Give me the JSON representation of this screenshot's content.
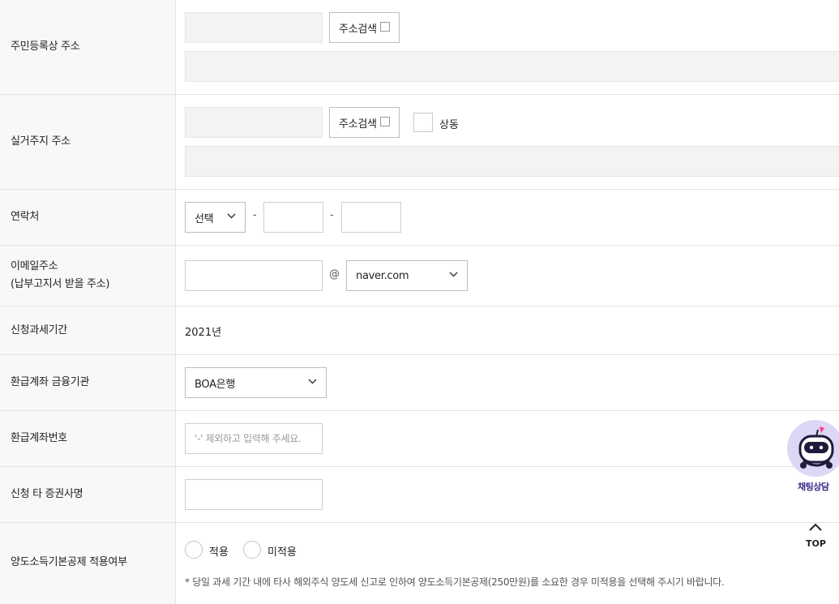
{
  "fields": {
    "resident_address": {
      "label": "주민등록상 주소",
      "search_button": "주소검색"
    },
    "actual_address": {
      "label": "실거주지 주소",
      "search_button": "주소검색",
      "same_checkbox_label": "상동"
    },
    "contact": {
      "label": "연락처",
      "prefix_selected": "선택",
      "separator": "-"
    },
    "email": {
      "label_line1": "이메일주소",
      "label_line2": "(납부고지서 받을 주소)",
      "at": "@",
      "domain_selected": "naver.com"
    },
    "tax_period": {
      "label": "신청과세기간",
      "value": "2021년"
    },
    "refund_bank": {
      "label": "환급계좌 금융기관",
      "selected": "BOA은행"
    },
    "refund_account": {
      "label": "환급계좌번호",
      "placeholder": "'-' 제외하고 입력해 주세요."
    },
    "other_broker": {
      "label": "신청 타 증권사명"
    },
    "deduction": {
      "label": "양도소득기본공제 적용여부",
      "options": [
        "적용",
        "미적용"
      ],
      "notice": "* 당일 과세 기간 내에 타사 해외주식 양도세 신고로 인하여 양도소득기본공제(250만원)를 소요한 경우 미적용을 선택해 주시기 바랍니다."
    }
  },
  "floating": {
    "chat_label": "채팅상담",
    "top_label": "TOP"
  },
  "colors": {
    "chat_accent": "#3b2a87",
    "chat_bubble": "#dcd7f5",
    "readonly_bg": "#f3f3f3",
    "label_bg": "#f8f8f8"
  }
}
